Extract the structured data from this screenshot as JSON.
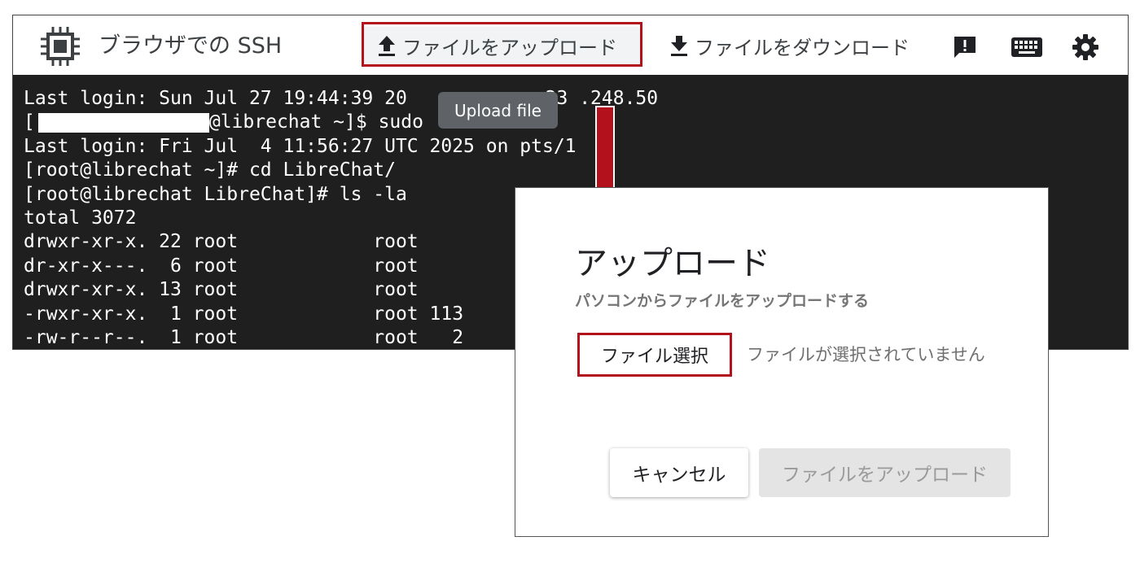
{
  "header": {
    "title": "ブラウザでの SSH",
    "upload_label": "ファイルをアップロード",
    "download_label": "ファイルをダウンロード",
    "icons": [
      "chip-icon",
      "upload-icon",
      "download-icon",
      "feedback-icon",
      "keyboard-icon",
      "gear-icon"
    ]
  },
  "tooltip": {
    "text": "Upload file"
  },
  "terminal": {
    "lines": [
      "Last login: Sun Jul 27 19:44:39 20",
      "[",
      "Last login: Fri Jul  4 11:56:27 UTC 2025 on pts/1",
      "[root@librechat ~]# cd LibreChat/",
      "[root@librechat LibreChat]# ls -la",
      "total 3072",
      "drwxr-xr-x. 22 root            root",
      "dr-xr-x---.  6 root            root",
      "drwxr-xr-x. 13 root            root",
      "-rwxr-xr-x.  1 root            root 113",
      "-rw-r--r--.  1 root            root   2"
    ],
    "line1_tail": ".23 .248.50",
    "line2_tail": "@librechat ~]$ sudo"
  },
  "dialog": {
    "title": "アップロード",
    "subtitle": "パソコンからファイルをアップロードする",
    "select_label": "ファイル選択",
    "no_file_text": "ファイルが選択されていません",
    "cancel_label": "キャンセル",
    "upload_label": "ファイルをアップロード"
  },
  "colors": {
    "highlight": "#b3121c",
    "terminal_bg": "#1f1f1f",
    "tooltip_bg": "#5f6368"
  }
}
